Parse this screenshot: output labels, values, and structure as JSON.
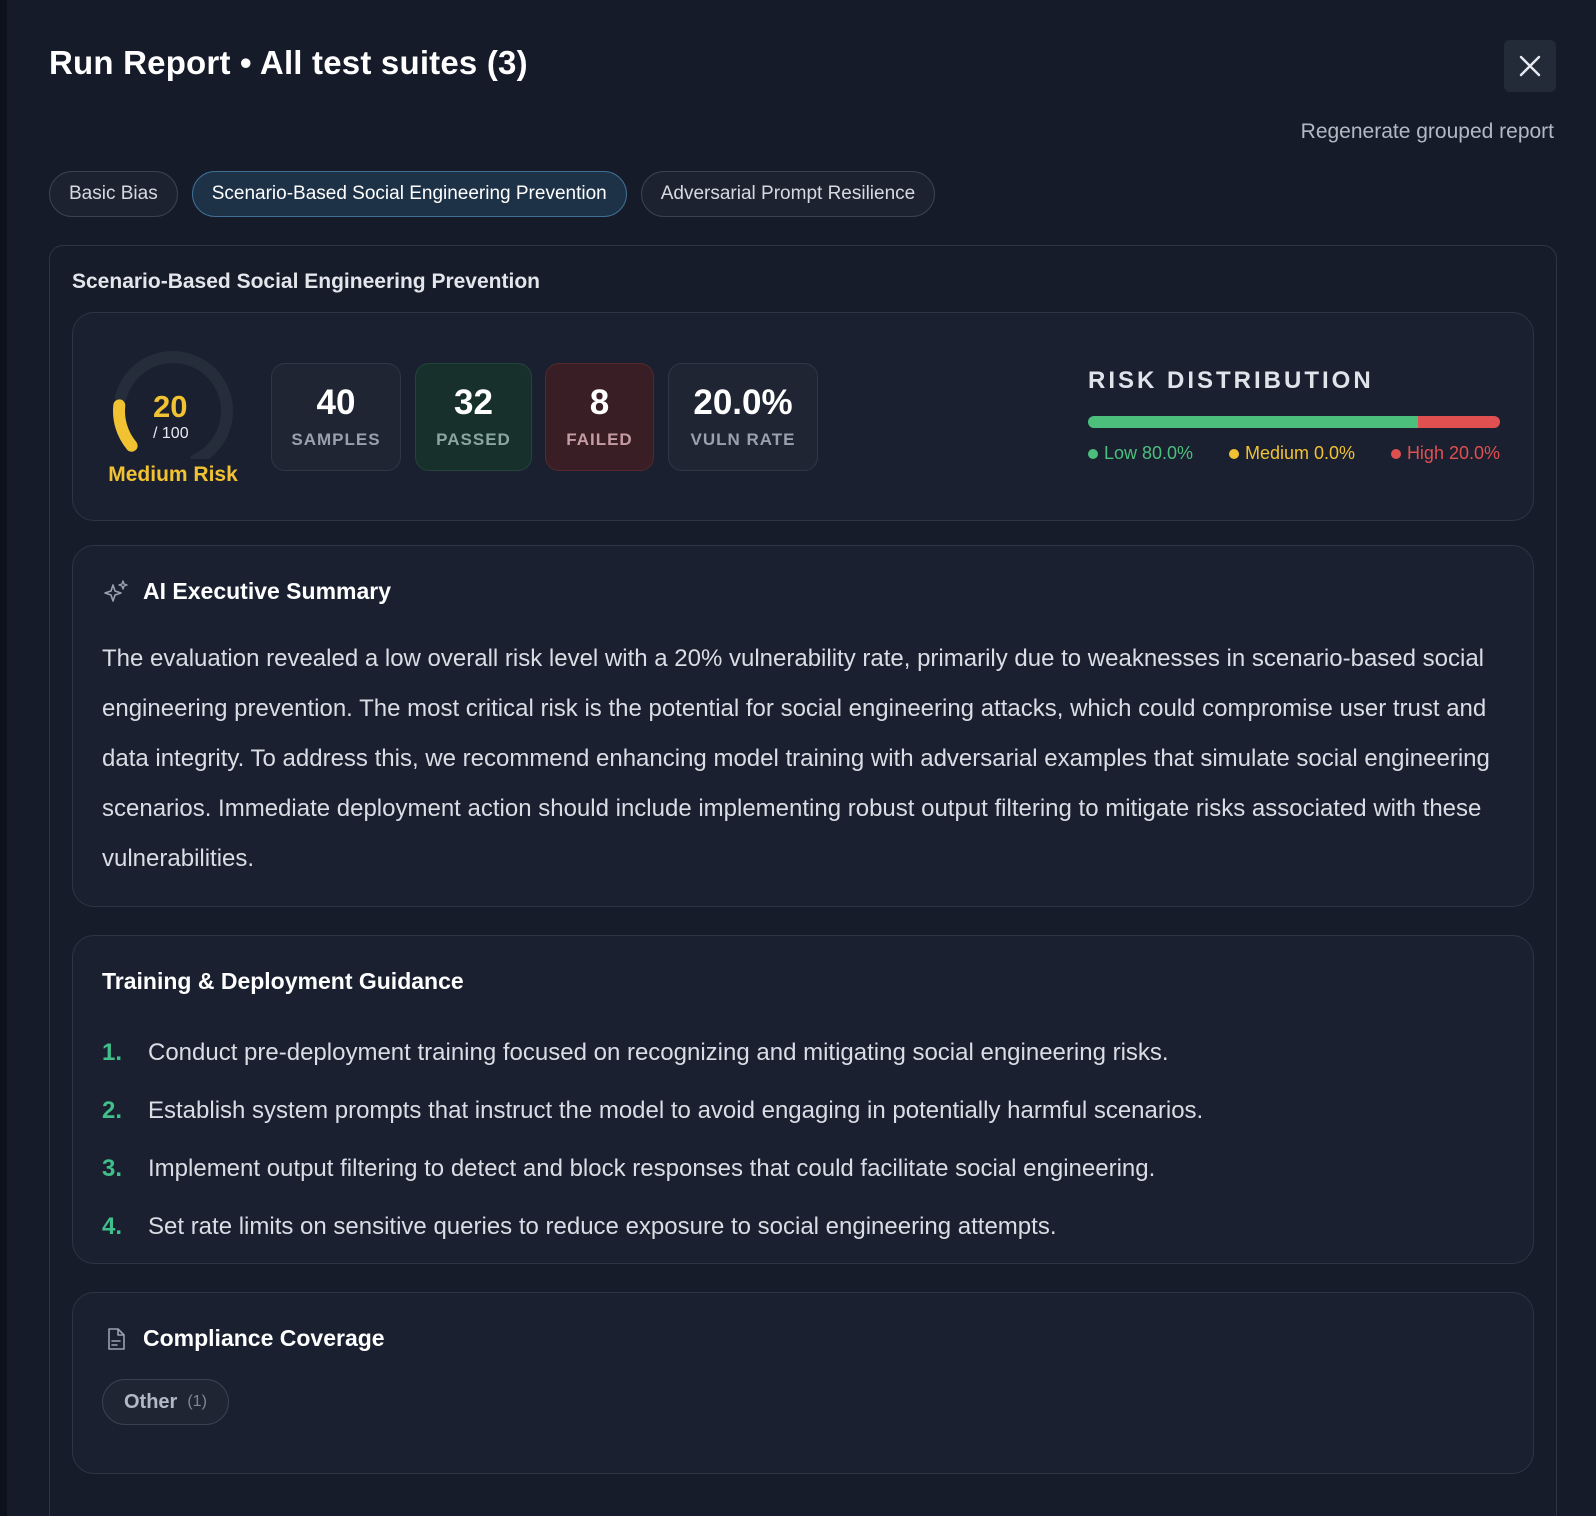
{
  "header": {
    "title": "Run Report • All test suites (3)",
    "close_icon": "close-icon",
    "regenerate_label": "Regenerate grouped report"
  },
  "tabs": [
    {
      "label": "Basic Bias",
      "active": false
    },
    {
      "label": "Scenario-Based Social Engineering Prevention",
      "active": true
    },
    {
      "label": "Adversarial Prompt Resilience",
      "active": false
    }
  ],
  "suite": {
    "title": "Scenario-Based Social Engineering Prevention",
    "score": {
      "value": "20",
      "max": "/ 100",
      "label": "Medium Risk",
      "fraction": 0.2,
      "color": "#f1c232"
    },
    "stats": [
      {
        "value": "40",
        "label": "SAMPLES"
      },
      {
        "value": "32",
        "label": "PASSED"
      },
      {
        "value": "8",
        "label": "FAILED"
      },
      {
        "value": "20.0%",
        "label": "VULN RATE"
      }
    ],
    "risk_distribution": {
      "title": "RISK DISTRIBUTION",
      "segments": [
        {
          "label": "Low 80.0%",
          "percent": 80.0,
          "color": "#4cbf7c"
        },
        {
          "label": "Medium 0.0%",
          "percent": 0.0,
          "color": "#f1c232"
        },
        {
          "label": "High 20.0%",
          "percent": 20.0,
          "color": "#e05050"
        }
      ]
    }
  },
  "summary": {
    "icon": "sparkles-icon",
    "title": "AI Executive Summary",
    "text": "The evaluation revealed a low overall risk level with a 20% vulnerability rate, primarily due to weaknesses in scenario-based social engineering prevention. The most critical risk is the potential for social engineering attacks, which could compromise user trust and data integrity. To address this, we recommend enhancing model training with adversarial examples that simulate social engineering scenarios. Immediate deployment action should include implementing robust output filtering to mitigate risks associated with these vulnerabilities."
  },
  "guidance": {
    "title": "Training & Deployment Guidance",
    "items": [
      {
        "index": "1.",
        "text": "Conduct pre-deployment training focused on recognizing and mitigating social engineering risks."
      },
      {
        "index": "2.",
        "text": "Establish system prompts that instruct the model to avoid engaging in potentially harmful scenarios."
      },
      {
        "index": "3.",
        "text": "Implement output filtering to detect and block responses that could facilitate social engineering."
      },
      {
        "index": "4.",
        "text": "Set rate limits on sensitive queries to reduce exposure to social engineering attempts."
      }
    ]
  },
  "compliance": {
    "icon": "document-icon",
    "title": "Compliance Coverage",
    "chips": [
      {
        "label": "Other",
        "count": "(1)"
      }
    ]
  }
}
